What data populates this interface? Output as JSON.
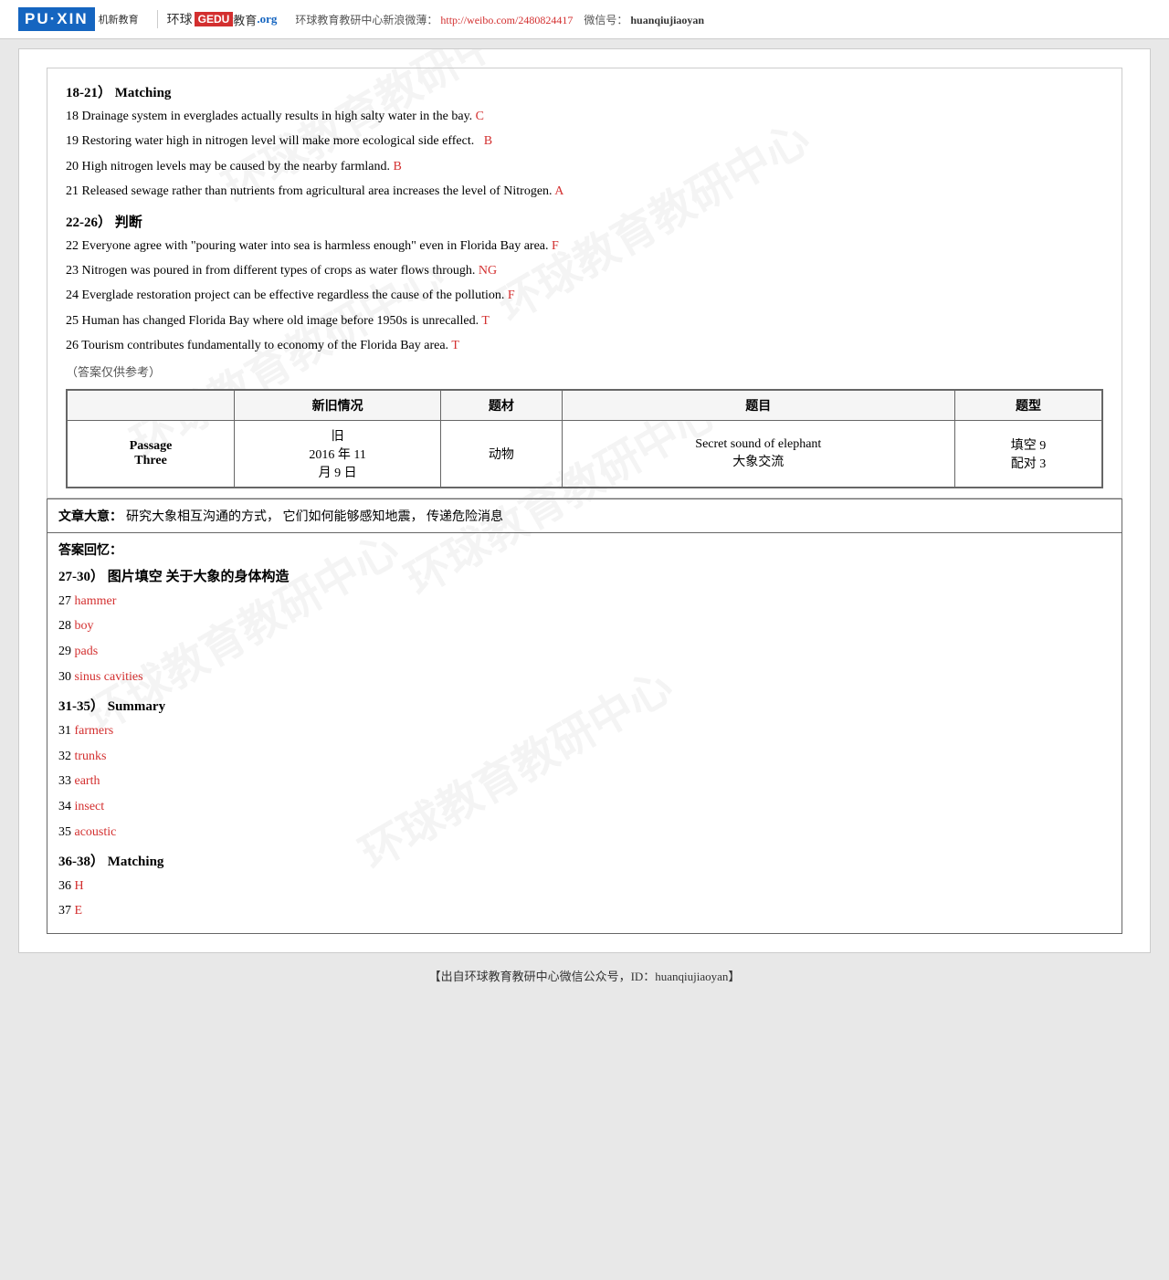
{
  "header": {
    "logo_puxin": "PU·XIN",
    "logo_puxin_sub": "机新教育",
    "logo_huanqiu": "环球",
    "logo_gedu": "GEDU",
    "logo_jiaoyu": "教育",
    "logo_org": ".org",
    "weibo_label": "环球教育教研中心新浪微薄：",
    "weibo_url": "http://weibo.com/2480824417",
    "weixin_label": "微信号：",
    "weixin_id": "huanqiujiaoyan"
  },
  "upper_section": {
    "heading_1821": "18-21） Matching",
    "q18": "18 Drainage system in everglades actually results in high salty water in the bay.",
    "q18_answer": "C",
    "q19": "19 Restoring water high in nitrogen level will make more ecological side effect.",
    "q19_answer": "B",
    "q20": "20 High nitrogen levels may be caused by the nearby farmland.",
    "q20_answer": "B",
    "q21": "21 Released sewage rather than nutrients from agricultural area increases the level of Nitrogen.",
    "q21_answer": "A",
    "heading_2226": "22-26） 判断",
    "q22": "22 Everyone agree with \"pouring water into sea is harmless enough\" even in Florida Bay area.",
    "q22_answer": "F",
    "q23": "23 Nitrogen was poured in from different types of crops as water flows through.",
    "q23_answer": "NG",
    "q24": "24 Everglade restoration project can be effective regardless the cause of the pollution.",
    "q24_answer": "F",
    "q25": "25 Human has changed Florida Bay where old image before 1950s is unrecalled.",
    "q25_answer": "T",
    "q26": "26 Tourism contributes fundamentally to economy of the Florida Bay area.",
    "q26_answer": "T",
    "note": "（答案仅供参考）"
  },
  "table": {
    "headers": [
      "新旧情况",
      "题材",
      "题目",
      "题型"
    ],
    "passage_label": "Passage\nThree",
    "col1": "旧\n2016 年 11\n月 9 日",
    "col2": "动物",
    "col3": "Secret sound of elephant\n大象交流",
    "col4": "填空 9\n配对 3"
  },
  "article_summary": {
    "heading": "文章大意：",
    "text": "研究大象相互沟通的方式，  它们如何能够感知地震，  传递危险消息"
  },
  "answers": {
    "heading": "答案回忆：",
    "sub1": "27-30） 图片填空 关于大象的身体构造",
    "q27_num": "27",
    "q27_ans": "hammer",
    "q28_num": "28",
    "q28_ans": "boy",
    "q29_num": "29",
    "q29_ans": "pads",
    "q30_num": "30",
    "q30_ans": "sinus cavities",
    "sub2": "31-35） Summary",
    "q31_num": "31",
    "q31_ans": "farmers",
    "q32_num": "32",
    "q32_ans": "trunks",
    "q33_num": "33",
    "q33_ans": "earth",
    "q34_num": "34",
    "q34_ans": "insect",
    "q35_num": "35",
    "q35_ans": "acoustic",
    "sub3": "36-38） Matching",
    "q36_num": "36",
    "q36_ans": "H",
    "q37_num": "37",
    "q37_ans": "E"
  },
  "footer": {
    "text": "【出自环球教育教研中心微信公众号，ID：huanqiujiaoyan】"
  }
}
